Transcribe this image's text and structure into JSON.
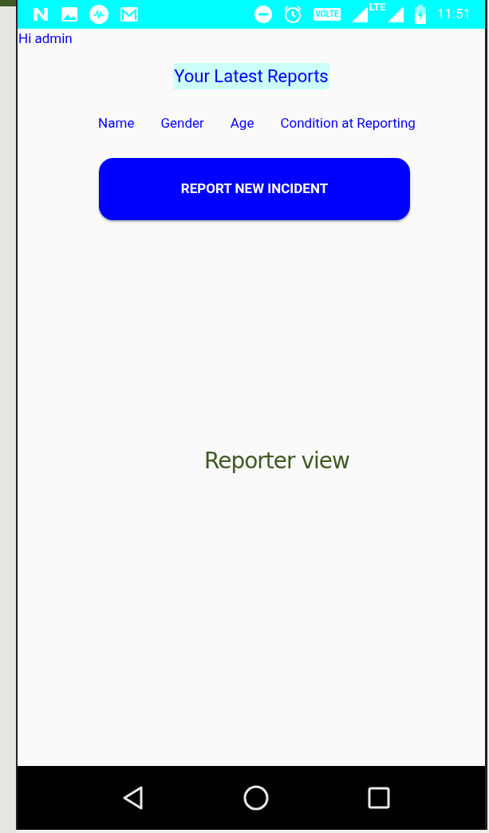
{
  "status_bar": {
    "volte_label": "VOLTE",
    "network_label": "LTE",
    "time": "11:51"
  },
  "greeting": "Hi admin",
  "title": "Your Latest Reports",
  "table": {
    "columns": [
      "Name",
      "Gender",
      "Age",
      "Condition at Reporting"
    ]
  },
  "primary_button": "REPORT NEW INCIDENT",
  "caption": "Reporter view"
}
